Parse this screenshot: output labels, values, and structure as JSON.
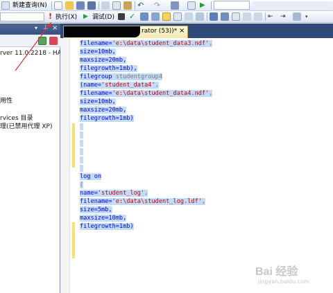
{
  "toolbar1": {
    "new_query_label": "新建查询(N)"
  },
  "toolbar2": {
    "execute_label": "执行(X)",
    "debug_label": "调试(D)"
  },
  "explorer": {
    "server_label": "rver 11.0.2218 - HA",
    "items": [
      "用性",
      "rvices 目录",
      "理(已禁用代理 XP)"
    ]
  },
  "editor": {
    "tab_title": "rator (53))*",
    "tab_close": "×",
    "lines": [
      {
        "parts": [
          {
            "t": "filename=",
            "c": "kw"
          },
          {
            "t": "'e:\\data\\student_data3.ndf'",
            "c": "str"
          },
          {
            "t": ",",
            "c": "gr"
          }
        ],
        "sel": true
      },
      {
        "parts": [
          {
            "t": "size=10mb,",
            "c": "kw"
          }
        ],
        "sel": true
      },
      {
        "parts": [
          {
            "t": "maxsize=20mb,",
            "c": "kw"
          }
        ],
        "sel": true
      },
      {
        "parts": [
          {
            "t": "filegrowth=1mb),",
            "c": "kw"
          }
        ],
        "sel": true
      },
      {
        "parts": [
          {
            "t": "filegroup",
            "c": "kw"
          },
          {
            "t": " studentgroup4",
            "c": "gr"
          }
        ],
        "sel": true
      },
      {
        "parts": [
          {
            "t": "(name=",
            "c": "kw"
          },
          {
            "t": "'student_data4'",
            "c": "str"
          },
          {
            "t": ",",
            "c": "gr"
          }
        ],
        "sel": true
      },
      {
        "parts": [
          {
            "t": "filename=",
            "c": "kw"
          },
          {
            "t": "'e:\\data\\student_data4.ndf'",
            "c": "str"
          },
          {
            "t": ",",
            "c": "gr"
          }
        ],
        "sel": true
      },
      {
        "parts": [
          {
            "t": "size=10mb,",
            "c": "kw"
          }
        ],
        "sel": true
      },
      {
        "parts": [
          {
            "t": "maxsize=20mb,",
            "c": "kw"
          }
        ],
        "sel": true
      },
      {
        "parts": [
          {
            "t": "filegrowth=1mb)",
            "c": "kw"
          }
        ],
        "sel": true
      },
      {
        "parts": [],
        "sel": true
      },
      {
        "parts": [],
        "sel": true
      },
      {
        "parts": [],
        "sel": true
      },
      {
        "parts": [],
        "sel": true
      },
      {
        "parts": [],
        "sel": true
      },
      {
        "parts": [],
        "sel": true
      },
      {
        "parts": [
          {
            "t": "log",
            "c": "kw"
          },
          {
            "t": " on",
            "c": "kw"
          }
        ],
        "sel": true
      },
      {
        "parts": [
          {
            "t": "(",
            "c": "gr"
          }
        ],
        "sel": true
      },
      {
        "parts": [
          {
            "t": "name=",
            "c": "kw"
          },
          {
            "t": "'student_log'",
            "c": "str"
          },
          {
            "t": ",",
            "c": "gr"
          }
        ],
        "sel": true
      },
      {
        "parts": [
          {
            "t": "filename=",
            "c": "kw"
          },
          {
            "t": "'e:\\data\\student_log.ldf'",
            "c": "str"
          },
          {
            "t": ",",
            "c": "gr"
          }
        ],
        "sel": true
      },
      {
        "parts": [
          {
            "t": "size=5mb,",
            "c": "kw"
          }
        ],
        "sel": true
      },
      {
        "parts": [
          {
            "t": "maxsize=10mb,",
            "c": "kw"
          }
        ],
        "sel": true
      },
      {
        "parts": [
          {
            "t": "filegrowth=1mb)",
            "c": "kw"
          }
        ],
        "sel": true
      }
    ]
  },
  "watermark": {
    "text": "Bai 经验",
    "sub": "jingyan.baidu.com"
  },
  "colors": {
    "selection": "#c2dbf7",
    "keyword": "#0000ff",
    "string": "#d10000",
    "arrow": "#e0302a"
  }
}
